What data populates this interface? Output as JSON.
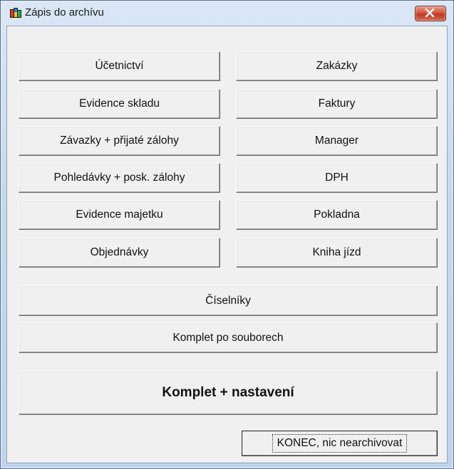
{
  "window": {
    "title": "Zápis do archívu",
    "icons": {
      "app": "archive-app-icon",
      "close": "close-x-icon"
    },
    "colors": {
      "close_button": "#c9432a",
      "client_bg": "#f0f0f0",
      "frame": "#c7d9ec"
    }
  },
  "left_buttons": [
    "Účetnictví",
    "Evidence skladu",
    "Závazky + přijaté zálohy",
    "Pohledávky + posk. zálohy",
    "Evidence majetku",
    "Objednávky"
  ],
  "right_buttons": [
    "Zakázky",
    "Faktury",
    "Manager",
    "DPH",
    "Pokladna",
    "Kniha jízd"
  ],
  "wide_buttons": {
    "ciselniky": "Číselníky",
    "komplet_po_souborech": "Komplet po souborech",
    "komplet_nastaveni": "Komplet + nastavení"
  },
  "exit_button": "KONEC, nic nearchivovat"
}
